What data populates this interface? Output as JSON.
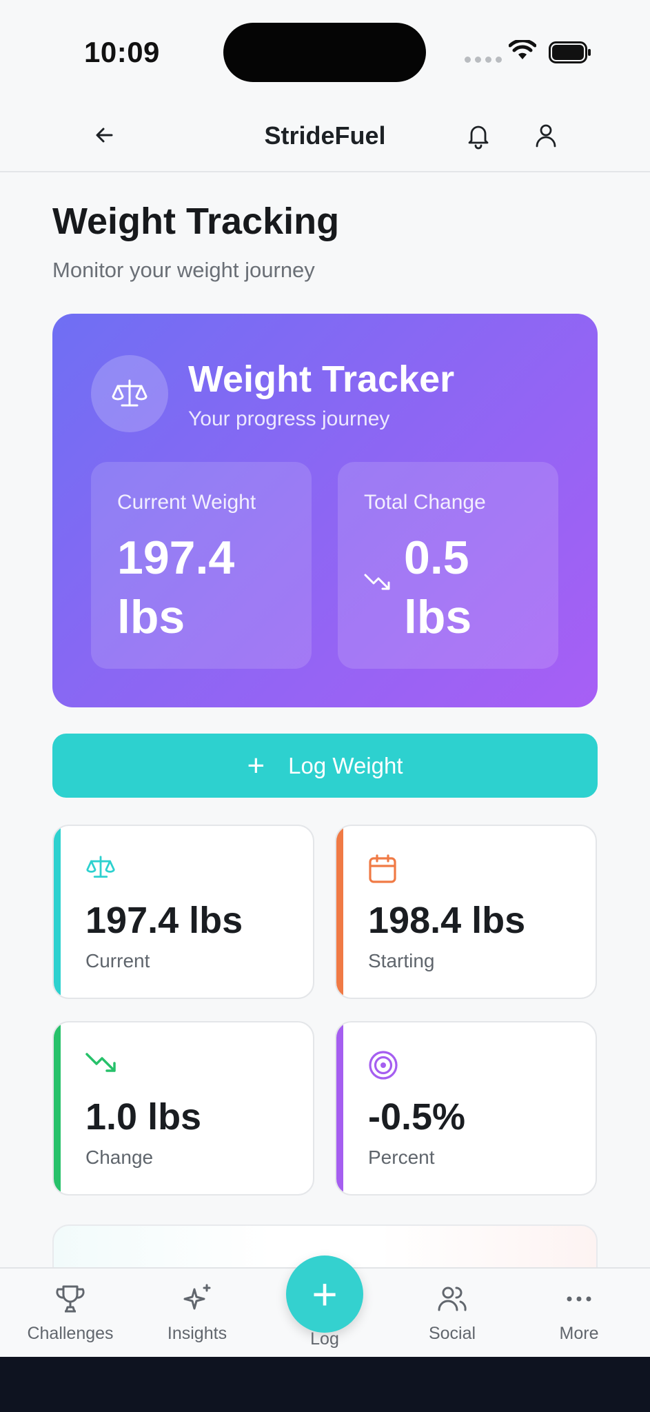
{
  "status_bar": {
    "time": "10:09"
  },
  "header": {
    "title": "StrideFuel"
  },
  "page": {
    "title": "Weight Tracking",
    "subtitle": "Monitor your weight journey"
  },
  "hero": {
    "title": "Weight Tracker",
    "subtitle": "Your progress journey",
    "current": {
      "label": "Current Weight",
      "value": "197.4",
      "unit": "lbs"
    },
    "change": {
      "label": "Total Change",
      "value": "0.5",
      "unit": "lbs"
    }
  },
  "log_button": {
    "label": "Log Weight"
  },
  "stats": [
    {
      "value": "197.4 lbs",
      "caption": "Current",
      "icon": "scale-icon",
      "accent": "#2dd1cf"
    },
    {
      "value": "198.4 lbs",
      "caption": "Starting",
      "icon": "calendar-icon",
      "accent": "#f07a45"
    },
    {
      "value": "1.0 lbs",
      "caption": "Change",
      "icon": "trending-down-icon",
      "accent": "#27c16a"
    },
    {
      "value": "-0.5%",
      "caption": "Percent",
      "icon": "target-icon",
      "accent": "#a55ef0"
    }
  ],
  "nav": {
    "challenges": "Challenges",
    "insights": "Insights",
    "log": "Log",
    "social": "Social",
    "more": "More"
  },
  "colors": {
    "primary": "#2dd1cf",
    "hero_start": "#6f6ff3",
    "hero_end": "#a75ff5"
  }
}
